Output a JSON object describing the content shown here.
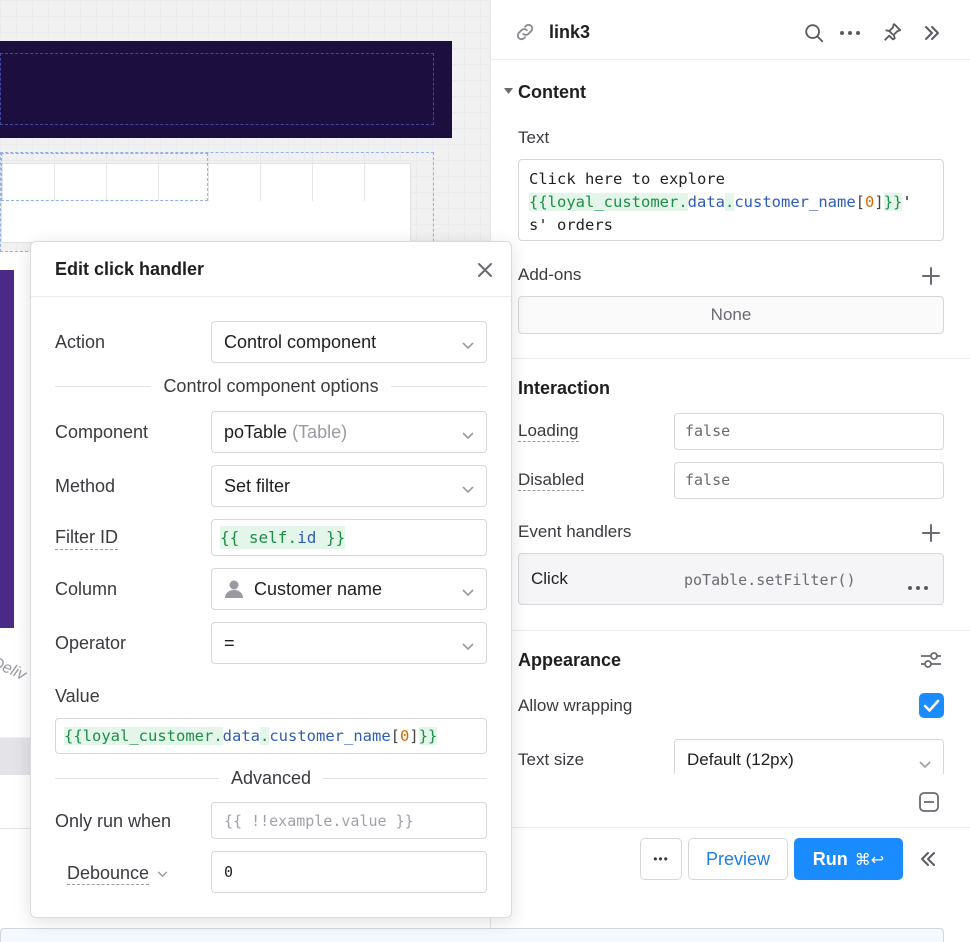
{
  "canvas": {
    "rotated_text": "Deliv"
  },
  "inspector": {
    "component_name": "link3",
    "content_section": "Content",
    "text_label": "Text",
    "text_value_line1": "Click here to explore",
    "text_value_code_open": "{{",
    "text_value_code_obj": "loyal_customer",
    "text_value_code_dot1": ".",
    "text_value_code_data": "data",
    "text_value_code_dot2": ".",
    "text_value_code_field": "customer_name",
    "text_value_code_br_open": "[",
    "text_value_code_idx": "0",
    "text_value_code_br_close": "]",
    "text_value_code_close": "}}",
    "text_value_tail": "'",
    "text_value_line3": "s' orders",
    "addons_label": "Add-ons",
    "addons_value": "None",
    "interaction_section": "Interaction",
    "loading_label": "Loading",
    "loading_value": "false",
    "disabled_label": "Disabled",
    "disabled_value": "false",
    "event_handlers_label": "Event handlers",
    "event_name": "Click",
    "event_action": "poTable.setFilter()",
    "appearance_section": "Appearance",
    "allow_wrapping_label": "Allow wrapping",
    "allow_wrapping_checked": true,
    "text_size_label": "Text size",
    "text_size_value": "Default (12px)"
  },
  "toolbar": {
    "more_label": "•••",
    "preview_label": "Preview",
    "run_label": "Run",
    "run_shortcut": "⌘↩",
    "run_color": "#1a8cff"
  },
  "popover": {
    "title": "Edit click handler",
    "action_label": "Action",
    "action_value": "Control component",
    "options_divider": "Control component options",
    "component_label": "Component",
    "component_value": "poTable",
    "component_type": "(Table)",
    "method_label": "Method",
    "method_value": "Set filter",
    "filter_id_label": "Filter ID",
    "filter_id_open": "{{ ",
    "filter_id_self": "self",
    "filter_id_dot": ".",
    "filter_id_id": "id",
    "filter_id_close": " }}",
    "column_label": "Column",
    "column_value": "Customer name",
    "operator_label": "Operator",
    "operator_value": "=",
    "value_label": "Value",
    "value_open": "{{",
    "value_obj": "loyal_customer",
    "value_dot1": ".",
    "value_data": "data",
    "value_dot2": ".",
    "value_field": "customer_name",
    "value_br_open": "[",
    "value_idx": "0",
    "value_br_close": "]",
    "value_close": "}}",
    "advanced_divider": "Advanced",
    "only_run_label": "Only run when",
    "only_run_placeholder": "{{ !!example.value }}",
    "debounce_label": "Debounce",
    "debounce_value": "0"
  }
}
